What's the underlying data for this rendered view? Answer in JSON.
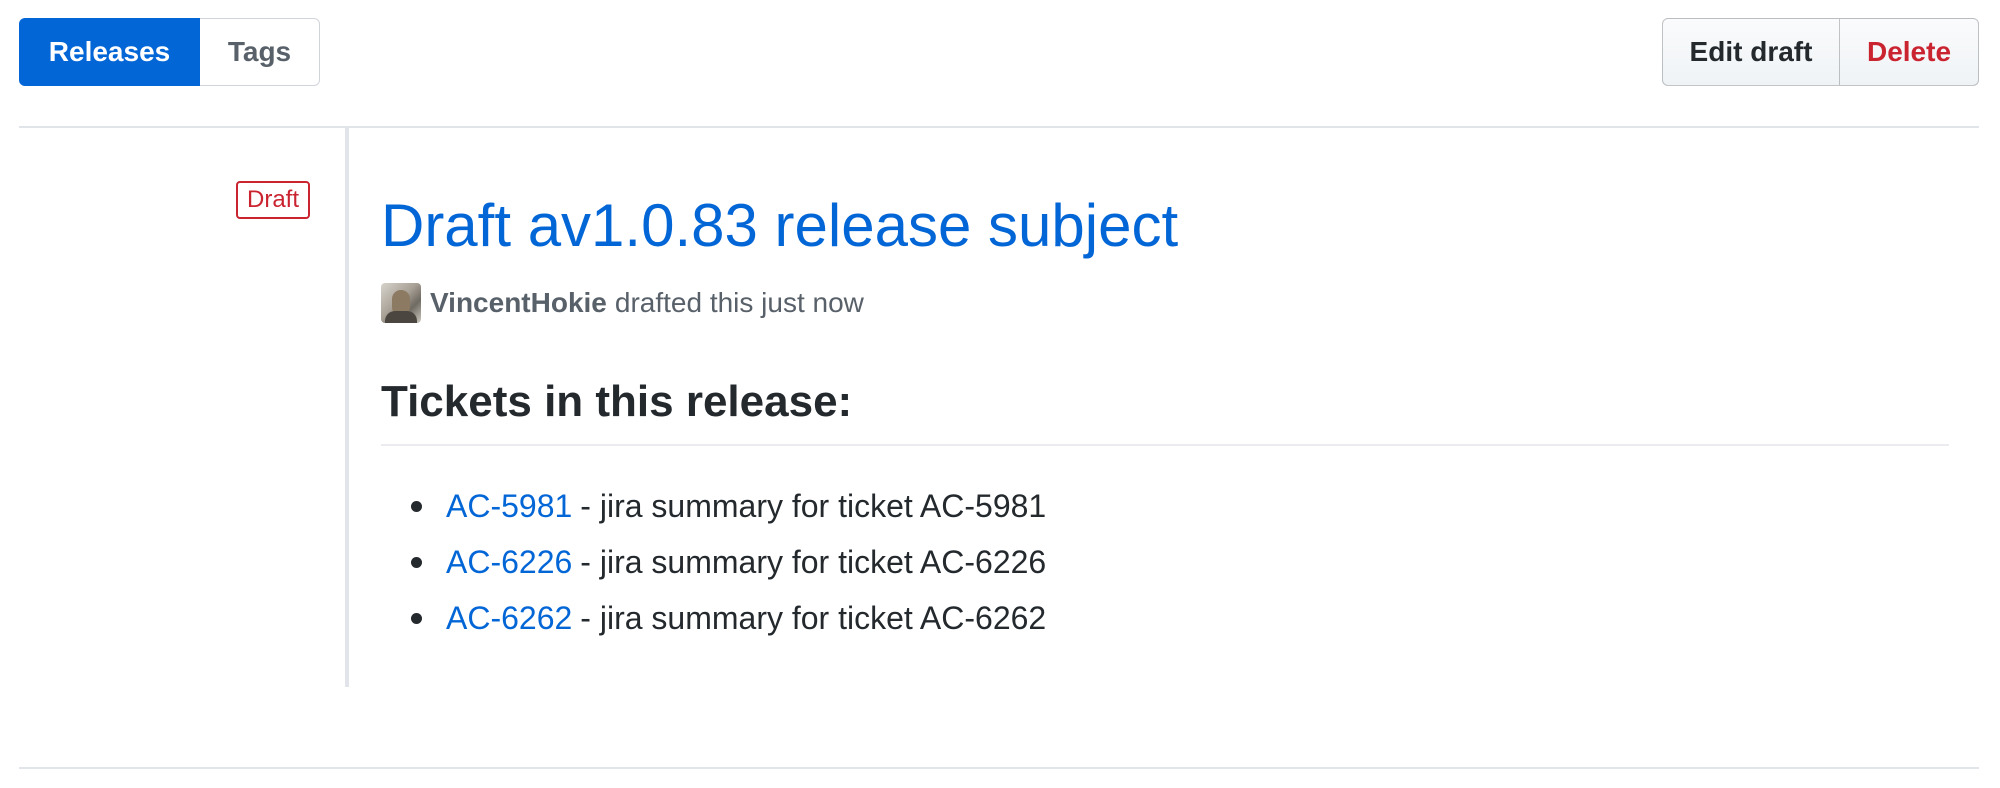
{
  "nav": {
    "tabs": [
      {
        "label": "Releases",
        "selected": true
      },
      {
        "label": "Tags",
        "selected": false
      }
    ]
  },
  "actions": {
    "edit_label": "Edit draft",
    "delete_label": "Delete"
  },
  "release": {
    "status_label": "Draft",
    "title": "Draft av1.0.83 release subject",
    "author": "VincentHokie",
    "action_text": "drafted this just now",
    "section_heading": "Tickets in this release:",
    "tickets": [
      {
        "key": "AC-5981",
        "summary": "- jira summary for ticket AC-5981"
      },
      {
        "key": "AC-6226",
        "summary": "- jira summary for ticket AC-6226"
      },
      {
        "key": "AC-6262",
        "summary": "- jira summary for ticket AC-6262"
      }
    ]
  },
  "colors": {
    "accent": "#0366d6",
    "danger": "#cb2431",
    "text": "#24292e",
    "muted": "#586069",
    "border": "#e1e4e8"
  },
  "icons": {
    "avatar": "user-avatar-photo"
  }
}
